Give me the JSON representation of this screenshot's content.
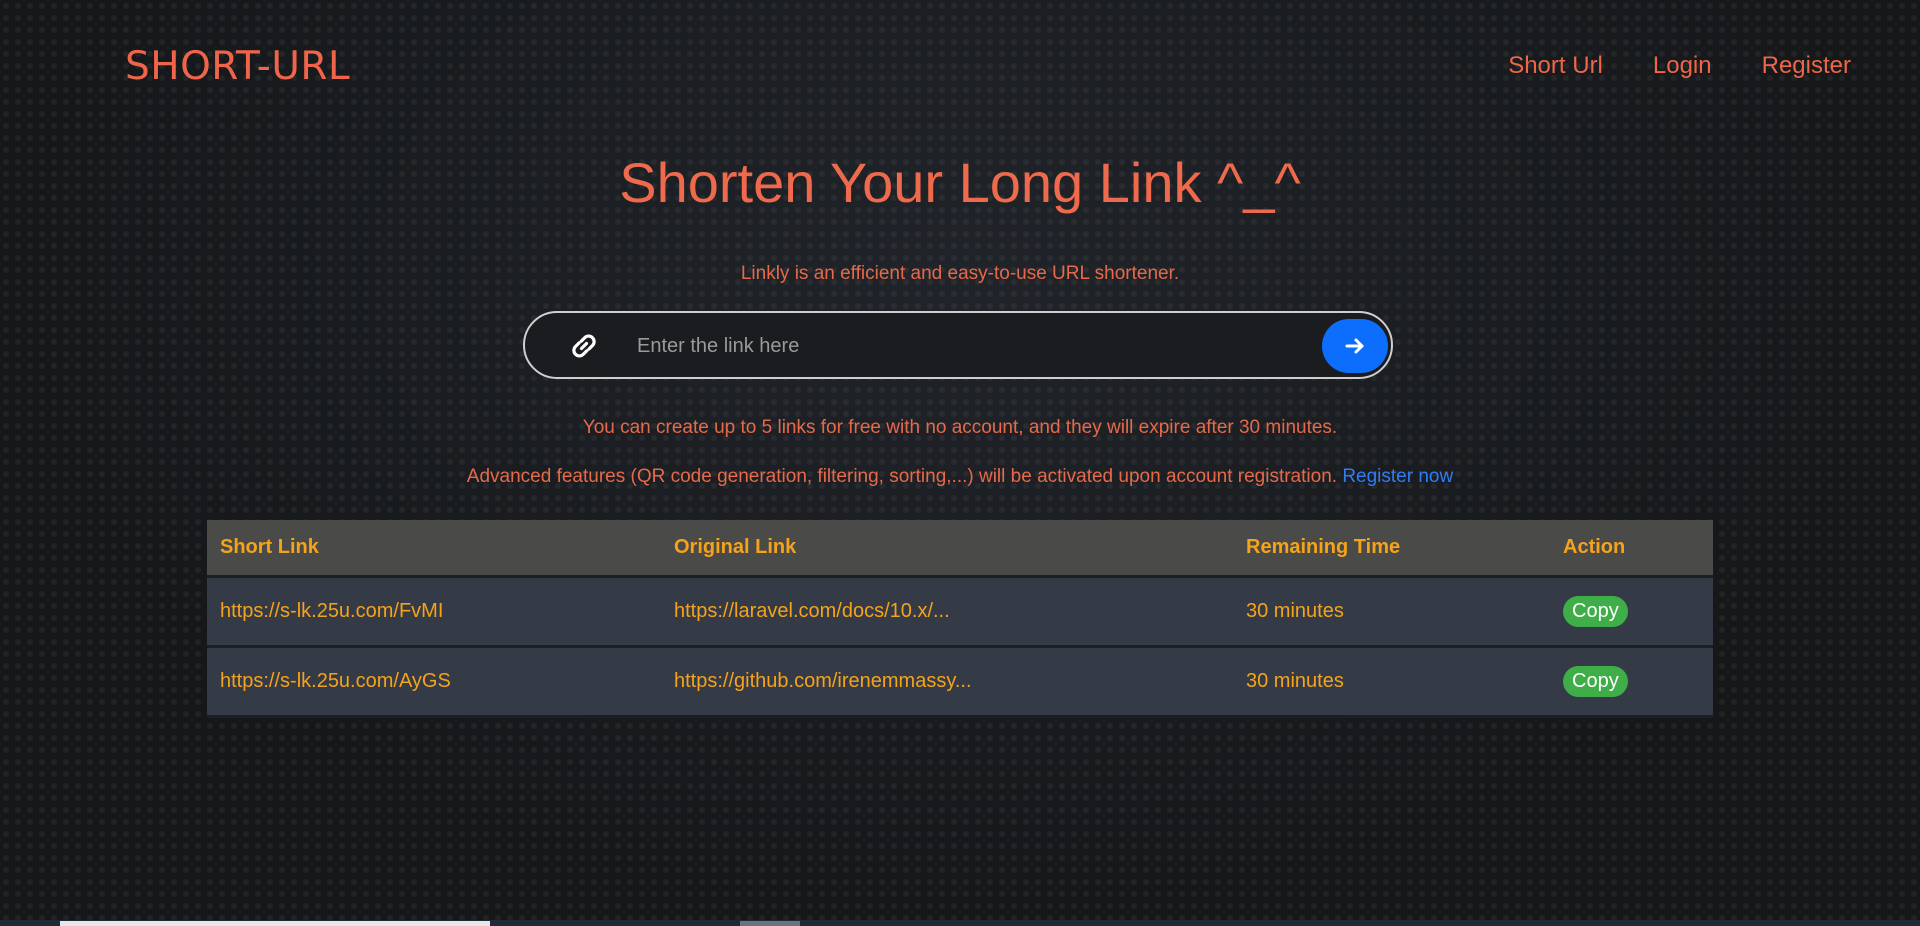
{
  "header": {
    "logo": "SHORT-URL",
    "nav": [
      "Short Url",
      "Login",
      "Register"
    ]
  },
  "hero": {
    "title": "Shorten Your Long Link ^_^",
    "subtitle": "Linkly is an efficient and easy-to-use URL shortener."
  },
  "search": {
    "placeholder": "Enter the link here",
    "value": ""
  },
  "notes": {
    "limit": "You can create up to 5 links for free with no account, and they will expire after 30 minutes.",
    "advanced": "Advanced features (QR code generation, filtering, sorting,...) will be activated upon account registration.",
    "register_link": "Register now"
  },
  "table": {
    "headers": [
      "Short Link",
      "Original Link",
      "Remaining Time",
      "Action"
    ],
    "rows": [
      {
        "short": "https://s-lk.25u.com/FvMI",
        "original": "https://laravel.com/docs/10.x/...",
        "time": "30 minutes",
        "action": "Copy"
      },
      {
        "short": "https://s-lk.25u.com/AyGS",
        "original": "https://github.com/irenemmassy...",
        "time": "30 minutes",
        "action": "Copy"
      }
    ]
  },
  "icons": {
    "link": "link-icon",
    "submit": "arrow-right-icon"
  },
  "colors": {
    "accent": "#ef6a4c",
    "table_text": "#f5a31a",
    "primary_button": "#0d6efd",
    "copy_button": "#3fae49",
    "link_blue": "#2f7cf6"
  }
}
